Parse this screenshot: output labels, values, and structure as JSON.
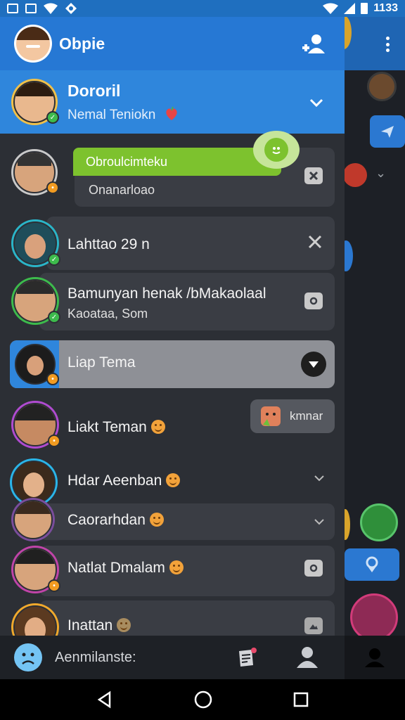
{
  "status_bar": {
    "time": "1133"
  },
  "drawer": {
    "header": {
      "title": "Obpie"
    },
    "current_user": {
      "name": "Dororil",
      "subtitle": "Nemal Teniokn"
    },
    "items": [
      {
        "bubble_text": "Obroulcimteku",
        "title": "Onanarloao",
        "action": "close-box"
      },
      {
        "title": "Lahttao 29 n",
        "action": "close"
      },
      {
        "title": "Bamunyan henak /bMakaolaal",
        "subtitle": "Kaoataa, Som",
        "action": "camera"
      },
      {
        "title": "Liap Tema",
        "action": "dropdown"
      },
      {
        "title": "Liakt Teman",
        "chip_label": "kmnar"
      },
      {
        "title": "Hdar Aeenban",
        "action": "chevron"
      },
      {
        "title": "Caorarhdan",
        "action": "chevron"
      },
      {
        "title": "Natlat Dmalam",
        "action": "camera"
      },
      {
        "title": "Inattan",
        "action": "image"
      }
    ],
    "bottom_bar": {
      "label": "Aenmilanste:"
    }
  },
  "colors": {
    "header_blue": "#2678d4",
    "highlight_blue": "#2f86dc",
    "bubble_green": "#7dc22e",
    "drawer_bg": "#2c2f35",
    "card_bg": "#3a3d44"
  }
}
